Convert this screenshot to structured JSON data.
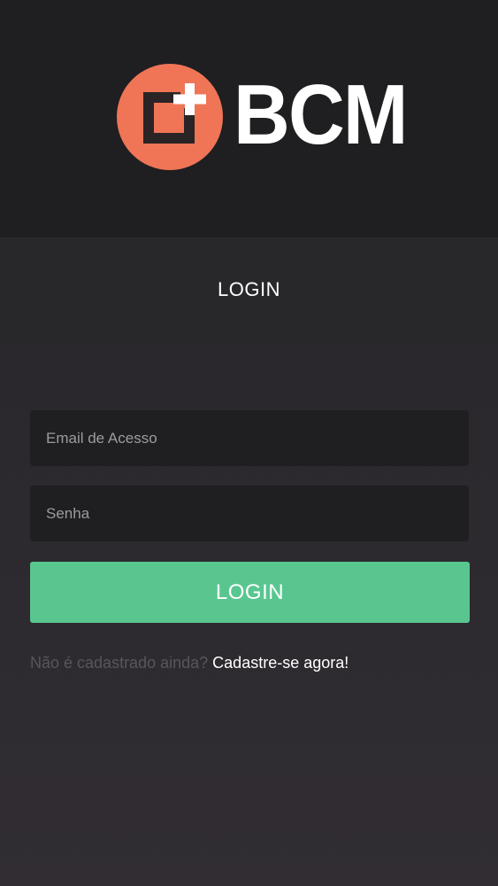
{
  "brand": {
    "name": "BCM",
    "accent_color": "#ef7556",
    "icon": "square-plus-logo-icon"
  },
  "header": {
    "title": "LOGIN"
  },
  "form": {
    "email_placeholder": "Email de Acesso",
    "password_placeholder": "Senha",
    "submit_label": "LOGIN",
    "submit_color": "#59c690"
  },
  "signup": {
    "question": "Não é cadastrado ainda?",
    "link_text": "Cadastre-se agora!"
  }
}
